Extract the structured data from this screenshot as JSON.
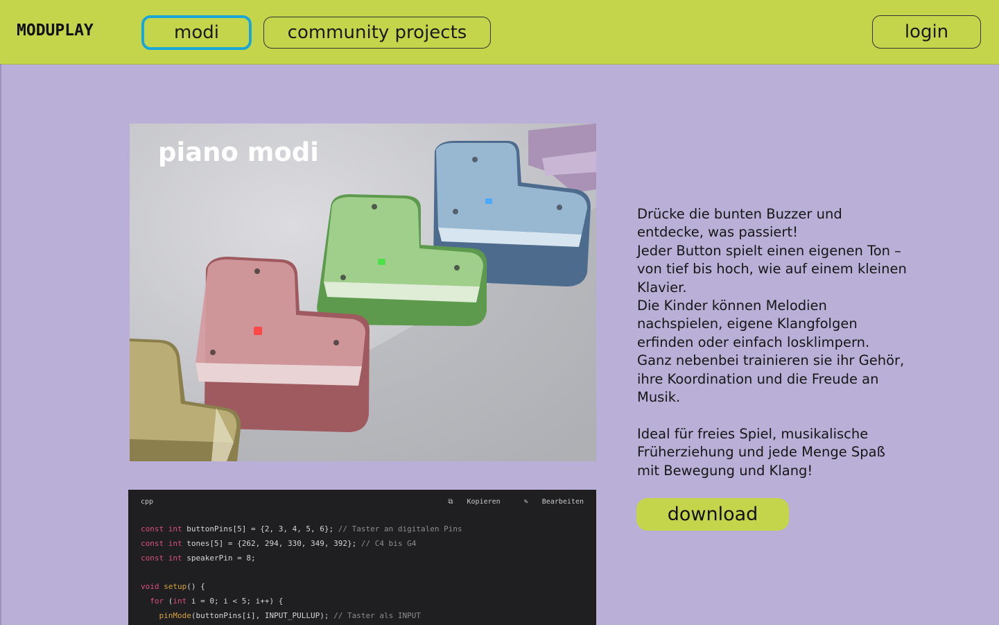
{
  "header": {
    "logo": "MODUPLAY",
    "nav": [
      {
        "label": "modi",
        "active": true
      },
      {
        "label": "community projects",
        "active": false
      }
    ],
    "login_label": "login",
    "colors": {
      "bar": "#c5d54b",
      "active_outline": "#1aa7d8"
    }
  },
  "product": {
    "title": "piano modi",
    "image_icon": "colored-l-shaped-buzzer-blocks",
    "description": [
      "Drücke die bunten Buzzer und",
      "entdecke, was passiert!",
      "Jeder Button spielt einen eigenen Ton –",
      "von tief bis hoch, wie auf einem kleinen",
      "Klavier.",
      "Die Kinder können Melodien",
      "nachspielen, eigene Klangfolgen",
      "erfinden oder einfach losklimpern.",
      "Ganz nebenbei trainieren sie ihr Gehör,",
      "ihre Koordination und die Freude an",
      "Musik.",
      "",
      "Ideal für freies Spiel, musikalische",
      "Früherziehung und jede Menge Spaß",
      "mit Bewegung und Klang!"
    ],
    "download_label": "download"
  },
  "code": {
    "language": "cpp",
    "copy_label": "Kopieren",
    "edit_label": "Bearbeiten",
    "lines": [
      "const int buttonPins[5] = {2, 3, 4, 5, 6}; // Taster an digitalen Pins",
      "const int tones[5] = {262, 294, 330, 349, 392}; // C4 bis G4",
      "const int speakerPin = 8;",
      "",
      "void setup() {",
      "  for (int i = 0; i < 5; i++) {",
      "    pinMode(buttonPins[i], INPUT_PULLUP); // Taster als INPUT"
    ]
  },
  "colors": {
    "page_bg": "#b9afd7",
    "accent": "#c5d54b",
    "code_bg": "#1f1f21"
  }
}
